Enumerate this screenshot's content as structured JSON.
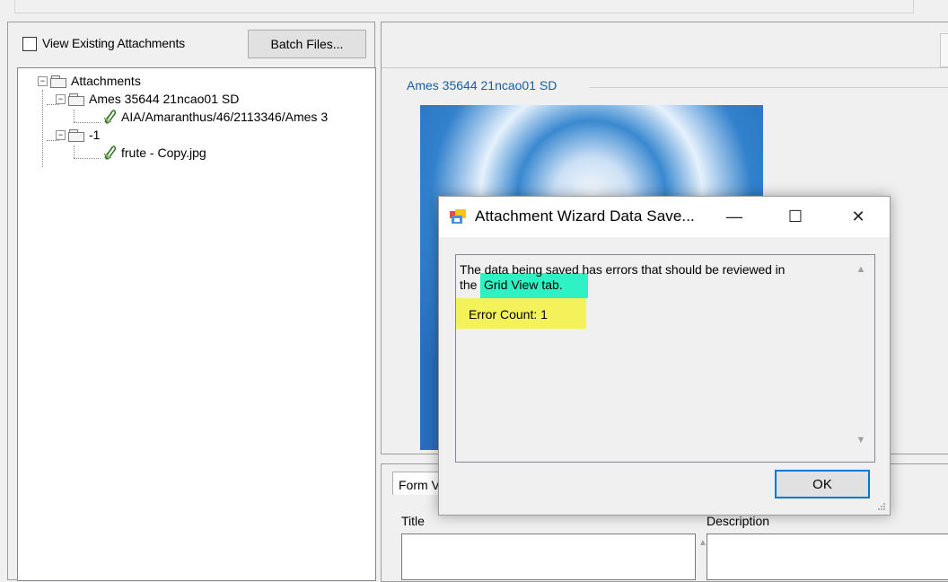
{
  "left_panel": {
    "view_existing_label": "View Existing Attachments",
    "view_existing_checked": false,
    "batch_files_label": "Batch Files...",
    "tree": {
      "root_label": "Attachments",
      "node1_label": "Ames 35644 21ncao01 SD",
      "node1_child_label": "AIA/Amaranthus/46/2113346/Ames 3",
      "node2_label": "-1",
      "node2_child_label": "frute - Copy.jpg",
      "icons": {
        "folder": "folder-icon",
        "attachment": "paperclip-icon"
      }
    }
  },
  "preview": {
    "group_title": "Ames 35644 21ncao01 SD"
  },
  "form": {
    "tab_label": "Form V",
    "title_label": "Title",
    "description_label": "Description"
  },
  "dialog": {
    "title": "Attachment Wizard Data Save...",
    "minimize_glyph": "—",
    "maximize_glyph": "☐",
    "close_glyph": "✕",
    "message_line1": "The data being saved has errors that should be reviewed in",
    "message_line2_prefix": "the",
    "message_highlight": "Grid View tab.",
    "error_count_text": "Error Count: 1",
    "ok_label": "OK",
    "highlight_colors": {
      "green": "#2ff2c4",
      "yellow": "#f4f25a"
    },
    "accent_color": "#0078d7"
  }
}
